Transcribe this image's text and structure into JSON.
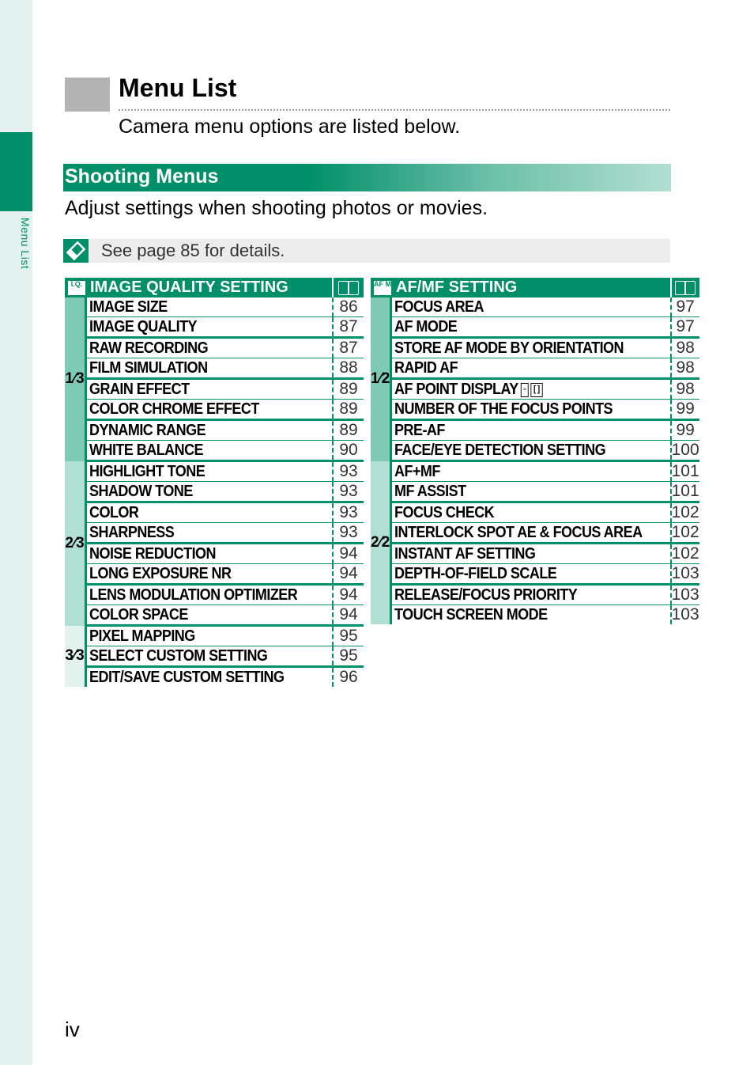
{
  "sidebar": {
    "label": "Menu List"
  },
  "header": {
    "title": "Menu List",
    "intro": "Camera menu options are listed below."
  },
  "section": {
    "title": "Shooting Menus",
    "description": "Adjust settings when shooting photos or movies.",
    "note_icon": "note-icon",
    "note": "See page 85 for details."
  },
  "tables": [
    {
      "icon_text": "I.Q.",
      "title": "IMAGE QUALITY SETTING",
      "page_icon": "book-icon",
      "groups": [
        {
          "label": "1⁄3",
          "rows": [
            {
              "name": "IMAGE SIZE",
              "page": "86"
            },
            {
              "name": "IMAGE QUALITY",
              "page": "87"
            },
            {
              "name": "RAW RECORDING",
              "page": "87"
            },
            {
              "name": "FILM SIMULATION",
              "page": "88"
            },
            {
              "name": "GRAIN EFFECT",
              "page": "89"
            },
            {
              "name": "COLOR CHROME EFFECT",
              "page": "89"
            },
            {
              "name": "DYNAMIC RANGE",
              "page": "89"
            },
            {
              "name": "WHITE BALANCE",
              "page": "90"
            }
          ]
        },
        {
          "label": "2⁄3",
          "rows": [
            {
              "name": "HIGHLIGHT TONE",
              "page": "93"
            },
            {
              "name": "SHADOW TONE",
              "page": "93"
            },
            {
              "name": "COLOR",
              "page": "93"
            },
            {
              "name": "SHARPNESS",
              "page": "93"
            },
            {
              "name": "NOISE REDUCTION",
              "page": "94"
            },
            {
              "name": "LONG EXPOSURE NR",
              "page": "94"
            },
            {
              "name": "LENS MODULATION OPTIMIZER",
              "page": "94"
            },
            {
              "name": "COLOR SPACE",
              "page": "94"
            }
          ]
        },
        {
          "label": "3⁄3",
          "rows": [
            {
              "name": "PIXEL MAPPING",
              "page": "95"
            },
            {
              "name": "SELECT CUSTOM SETTING",
              "page": "95"
            },
            {
              "name": "EDIT/SAVE CUSTOM SETTING",
              "page": "96"
            }
          ]
        }
      ]
    },
    {
      "icon_text": "AF MF",
      "title": "AF/MF SETTING",
      "page_icon": "book-icon",
      "groups": [
        {
          "label": "1⁄2",
          "rows": [
            {
              "name": "FOCUS AREA",
              "page": "97"
            },
            {
              "name": "AF MODE",
              "page": "97"
            },
            {
              "name": "STORE AF MODE BY ORIENTATION",
              "page": "98"
            },
            {
              "name": "RAPID AF",
              "page": "98"
            },
            {
              "name": "AF POINT DISPLAY",
              "page": "98",
              "icons": [
                "af-point-small-icon",
                "af-point-large-icon"
              ]
            },
            {
              "name": "NUMBER OF THE FOCUS POINTS",
              "page": "99"
            },
            {
              "name": "PRE-AF",
              "page": "99"
            },
            {
              "name": "FACE/EYE DETECTION SETTING",
              "page": "100"
            }
          ]
        },
        {
          "label": "2⁄2",
          "rows": [
            {
              "name": "AF+MF",
              "page": "101"
            },
            {
              "name": "MF ASSIST",
              "page": "101"
            },
            {
              "name": "FOCUS CHECK",
              "page": "102"
            },
            {
              "name": "INTERLOCK SPOT AE & FOCUS AREA",
              "page": "102"
            },
            {
              "name": "INSTANT AF SETTING",
              "page": "102"
            },
            {
              "name": "DEPTH-OF-FIELD SCALE",
              "page": "103"
            },
            {
              "name": "RELEASE/FOCUS PRIORITY",
              "page": "103"
            },
            {
              "name": "TOUCH SCREEN MODE",
              "page": "103"
            }
          ]
        }
      ]
    }
  ],
  "footer": {
    "page_number": "iv"
  }
}
